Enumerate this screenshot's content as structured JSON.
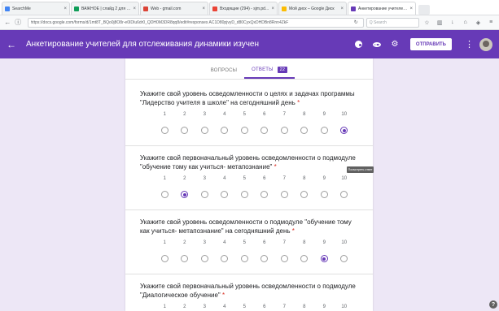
{
  "browser": {
    "tabs": [
      {
        "label": "SearchMe",
        "color": "#4285f4",
        "active": false
      },
      {
        "label": "ВАЖНОЕ | слайд 2 для 1 ...",
        "color": "#0f9d58",
        "active": false
      },
      {
        "label": "Web - gmail.com",
        "color": "#db4437",
        "active": false
      },
      {
        "label": "Входящие (294) - sjm.pd...",
        "color": "#ea4335",
        "active": false
      },
      {
        "label": "Мой диск – Google Диск",
        "color": "#fbbc04",
        "active": false
      },
      {
        "label": "Анкетирование учителей...",
        "color": "#673ab7",
        "active": true
      }
    ],
    "url": "https://docs.google.com/forms/d/1mt8T_BQo0j8O8r-e0IDIu6dr0_QDH0M3DR8qq8/edit#responses AC1D80pjvyD_d80CyxQxDHDBn8Rnn4ZkF",
    "search_placeholder": "Q Search"
  },
  "appbar": {
    "title": "Анкетирование учителей для отслеживания динамики изучен",
    "send_label": "ОТПРАВИТЬ",
    "background": "#673ab7"
  },
  "form_tabs": {
    "questions_label": "ВОПРОСЫ",
    "responses_label": "ОТВЕТЫ",
    "responses_count": "22"
  },
  "scale_numbers": [
    "1",
    "2",
    "3",
    "4",
    "5",
    "6",
    "7",
    "8",
    "9",
    "10"
  ],
  "questions": [
    {
      "text": "Укажите свой уровень осведомленности о целях и задачах программы \"Лидерство учителя в школе\" на сегодняшний день",
      "required": "*",
      "selected": 10
    },
    {
      "text": "Укажите свой первоначальный уровень осведомленности о подмодуле \"обучение тому как учиться- метапознание\"",
      "required": "*",
      "selected": 2
    },
    {
      "text": "Укажите свой уровень осведомленности о подмодуле \"обучение тому как учиться- метапознание\" на сегодняшний день",
      "required": "*",
      "selected": 9
    },
    {
      "text": "Укажите свой первоначальный уровень осведомленности о подмодуле \"Диалогическое обучение\"",
      "required": "*",
      "selected": 0
    }
  ],
  "tooltip": "Посмотреть ответ",
  "help_label": "?"
}
